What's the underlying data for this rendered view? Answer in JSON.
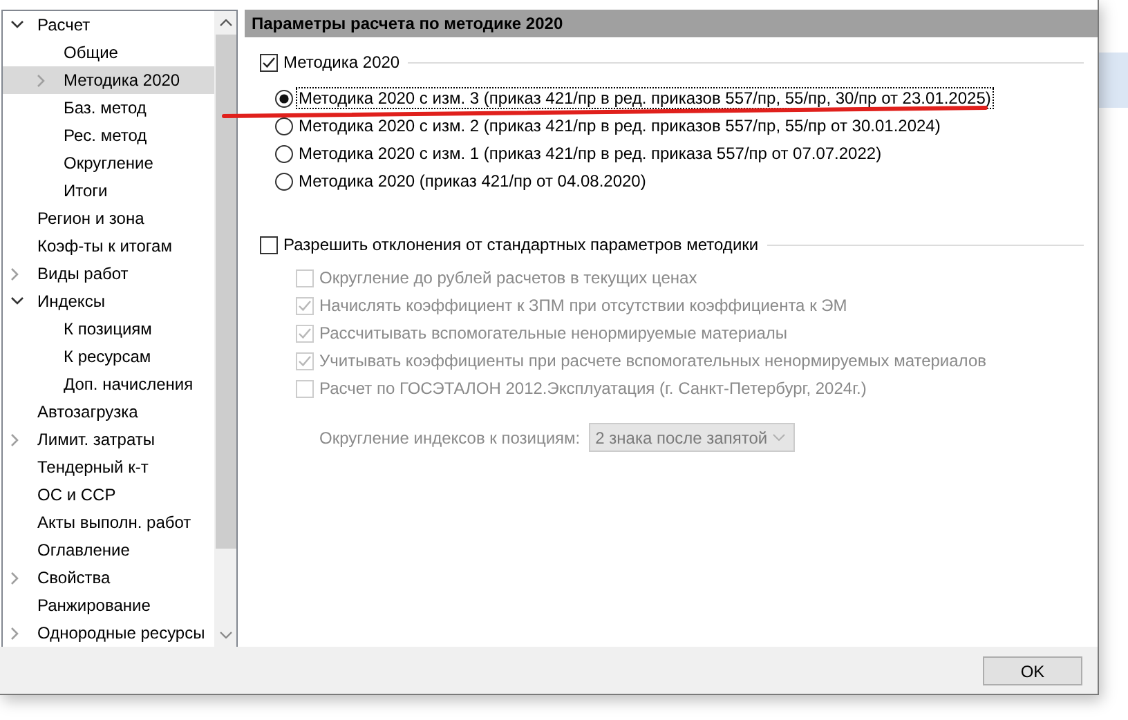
{
  "tree": [
    {
      "label": "Расчет",
      "selected": false,
      "expanded": true,
      "children": [
        {
          "label": "Общие",
          "selected": false
        },
        {
          "label": "Методика 2020",
          "selected": true,
          "expanded": false
        },
        {
          "label": "Баз. метод",
          "selected": false
        },
        {
          "label": "Рес. метод",
          "selected": false
        },
        {
          "label": "Округление",
          "selected": false
        },
        {
          "label": "Итоги",
          "selected": false
        }
      ]
    },
    {
      "label": "Регион и зона",
      "selected": false
    },
    {
      "label": "Коэф-ты к итогам",
      "selected": false
    },
    {
      "label": "Виды работ",
      "selected": false,
      "expanded": false
    },
    {
      "label": "Индексы",
      "selected": false,
      "expanded": true,
      "children": [
        {
          "label": "К позициям",
          "selected": false
        },
        {
          "label": "К ресурсам",
          "selected": false
        },
        {
          "label": "Доп. начисления",
          "selected": false
        }
      ]
    },
    {
      "label": "Автозагрузка",
      "selected": false
    },
    {
      "label": "Лимит. затраты",
      "selected": false,
      "expanded": false
    },
    {
      "label": "Тендерный к-т",
      "selected": false
    },
    {
      "label": "ОС и ССР",
      "selected": false
    },
    {
      "label": "Акты выполн. работ",
      "selected": false
    },
    {
      "label": "Оглавление",
      "selected": false
    },
    {
      "label": "Свойства",
      "selected": false,
      "expanded": false
    },
    {
      "label": "Ранжирование",
      "selected": false
    },
    {
      "label": "Однородные ресурсы",
      "selected": false,
      "expanded": false
    }
  ],
  "panel": {
    "title": "Параметры расчета по методике 2020"
  },
  "method_group": {
    "label": "Методика 2020",
    "checked": true
  },
  "methods": [
    {
      "label": "Методика 2020 с изм. 3 (приказ 421/пр в ред. приказов 557/пр, 55/пр, 30/пр от 23.01.2025)",
      "selected": true,
      "focused": true
    },
    {
      "label": "Методика 2020 с изм. 2 (приказ 421/пр в ред. приказов 557/пр, 55/пр от 30.01.2024)",
      "selected": false,
      "focused": false
    },
    {
      "label": "Методика 2020 с изм. 1 (приказ 421/пр в ред. приказа 557/пр от 07.07.2022)",
      "selected": false,
      "focused": false
    },
    {
      "label": "Методика 2020 (приказ 421/пр от 04.08.2020)",
      "selected": false,
      "focused": false
    }
  ],
  "deviations_group": {
    "label": "Разрешить отклонения от стандартных параметров методики",
    "checked": false
  },
  "options": [
    {
      "label": "Округление до рублей расчетов в текущих ценах",
      "checked": false,
      "disabled": true
    },
    {
      "label": "Начислять коэффициент к ЗПМ при отсутствии коэффициента к ЭМ",
      "checked": true,
      "disabled": true
    },
    {
      "label": "Рассчитывать вспомогательные ненормируемые материалы",
      "checked": true,
      "disabled": true
    },
    {
      "label": "Учитывать коэффициенты при расчете вспомогательных ненормируемых материалов",
      "checked": true,
      "disabled": true
    },
    {
      "label": "Расчет по ГОСЭТАЛОН 2012.Эксплуатация (г. Санкт-Петербург, 2024г.)",
      "checked": false,
      "disabled": true
    }
  ],
  "rounding": {
    "label": "Округление индексов к позициям:",
    "value": "2 знака после запятой",
    "disabled": true
  },
  "buttons": [
    {
      "label": "OK"
    }
  ]
}
